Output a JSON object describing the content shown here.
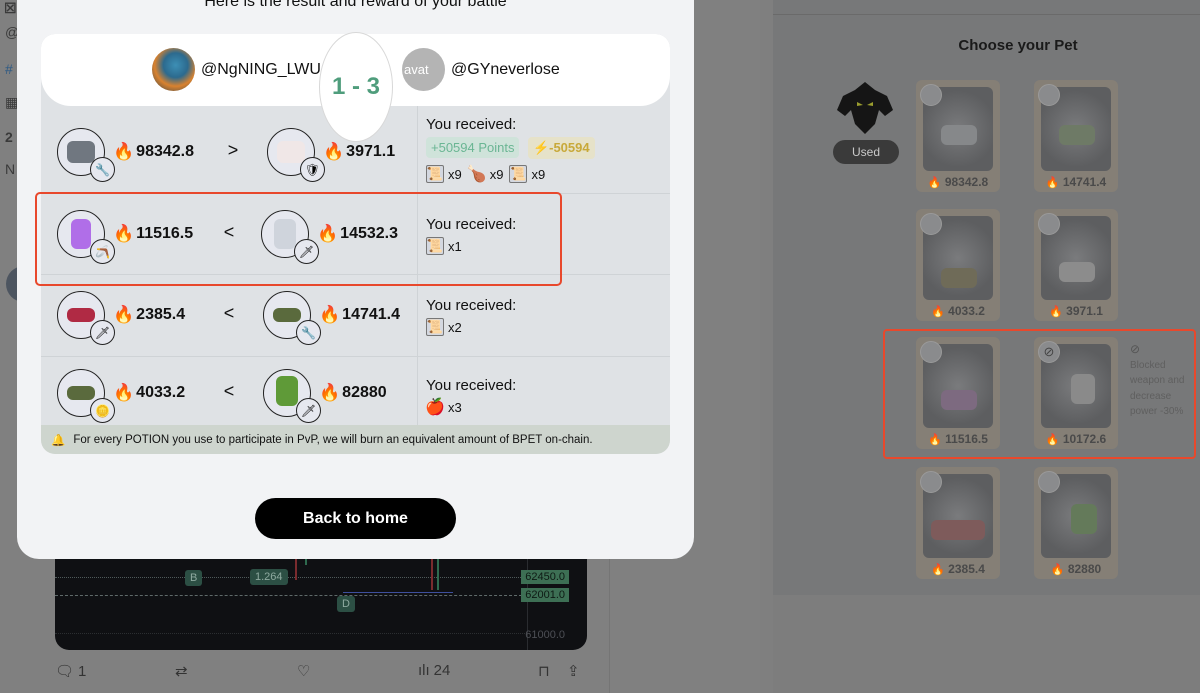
{
  "modal": {
    "subtitle": "Here is the result and reward of your battle",
    "player_left": {
      "handle": "@NgNING_LWU"
    },
    "player_right": {
      "handle": "@GYneverlose",
      "avatar_alt": "avat"
    },
    "score": "1 - 3",
    "rows": [
      {
        "left_power": "98342.8",
        "comparison": ">",
        "right_power": "3971.1",
        "left_pet_icon": "gray-cat-pet-icon",
        "left_weapon_icon": "wrench-icon",
        "right_pet_icon": "white-bunny-pet-icon",
        "right_weapon_icon": "shield-icon",
        "reward_title": "You received:",
        "points_chip": "+50594 Points",
        "energy_chip": "-50594",
        "items": [
          {
            "icon": "scroll-item-icon",
            "qty": "x9"
          },
          {
            "icon": "drumstick-item-icon",
            "qty": "x9"
          },
          {
            "icon": "scroll-item-icon",
            "qty": "x9"
          }
        ]
      },
      {
        "left_power": "11516.5",
        "comparison": "<",
        "right_power": "14532.3",
        "left_pet_icon": "purple-pet-icon",
        "left_weapon_icon": "boomerang-icon",
        "right_pet_icon": "white-astronaut-pet-icon",
        "right_weapon_icon": "sword-icon",
        "reward_title": "You received:",
        "items": [
          {
            "icon": "scroll-item-icon",
            "qty": "x1"
          }
        ]
      },
      {
        "left_power": "2385.4",
        "comparison": "<",
        "right_power": "14741.4",
        "left_pet_icon": "red-spiky-pet-icon",
        "left_weapon_icon": "golden-sword-icon",
        "right_pet_icon": "turtle-pet-icon",
        "right_weapon_icon": "wrench-icon",
        "reward_title": "You received:",
        "items": [
          {
            "icon": "scroll-item-icon",
            "qty": "x2"
          }
        ]
      },
      {
        "left_power": "4033.2",
        "comparison": "<",
        "right_power": "82880",
        "left_pet_icon": "turtle-pet-icon",
        "left_weapon_icon": "gold-coin-shield-icon",
        "right_pet_icon": "tree-pet-icon",
        "right_weapon_icon": "red-sword-icon",
        "reward_title": "You received:",
        "items": [
          {
            "icon": "apple-item-icon",
            "qty": "x3"
          }
        ]
      }
    ],
    "notice": "For every POTION you use to participate in PvP, we will burn an equivalent amount of BPET on-chain.",
    "back_button": "Back to home"
  },
  "pet_panel": {
    "title": "Choose your Pet",
    "used_label": "Used",
    "pets": [
      {
        "power": "98342.8",
        "weapon": "wrench-icon"
      },
      {
        "power": "14741.4",
        "weapon": "wrench-icon"
      },
      {
        "power": "4033.2",
        "weapon": "gold-coin-shield-icon"
      },
      {
        "power": "3971.1",
        "weapon": "shield-icon"
      },
      {
        "power": "11516.5",
        "weapon": "boomerang-icon"
      },
      {
        "power": "10172.6",
        "weapon": "blocked-icon"
      },
      {
        "power": "2385.4",
        "weapon": "golden-sword-icon"
      },
      {
        "power": "82880",
        "weapon": "red-sword-icon"
      }
    ],
    "blocked_note": "Blocked weapon and decrease power -30%"
  },
  "tweet": {
    "chart_labels": {
      "b": "B",
      "ratio": "1.264",
      "d": "D"
    },
    "prices": [
      "62450.0",
      "62001.0",
      "61000.0"
    ],
    "actions": {
      "replies": "1",
      "views": "24"
    }
  },
  "colors": {
    "score_green": "#4f9d7c",
    "highlight_red": "#e8482c",
    "fire_orange": "#f04a18"
  }
}
